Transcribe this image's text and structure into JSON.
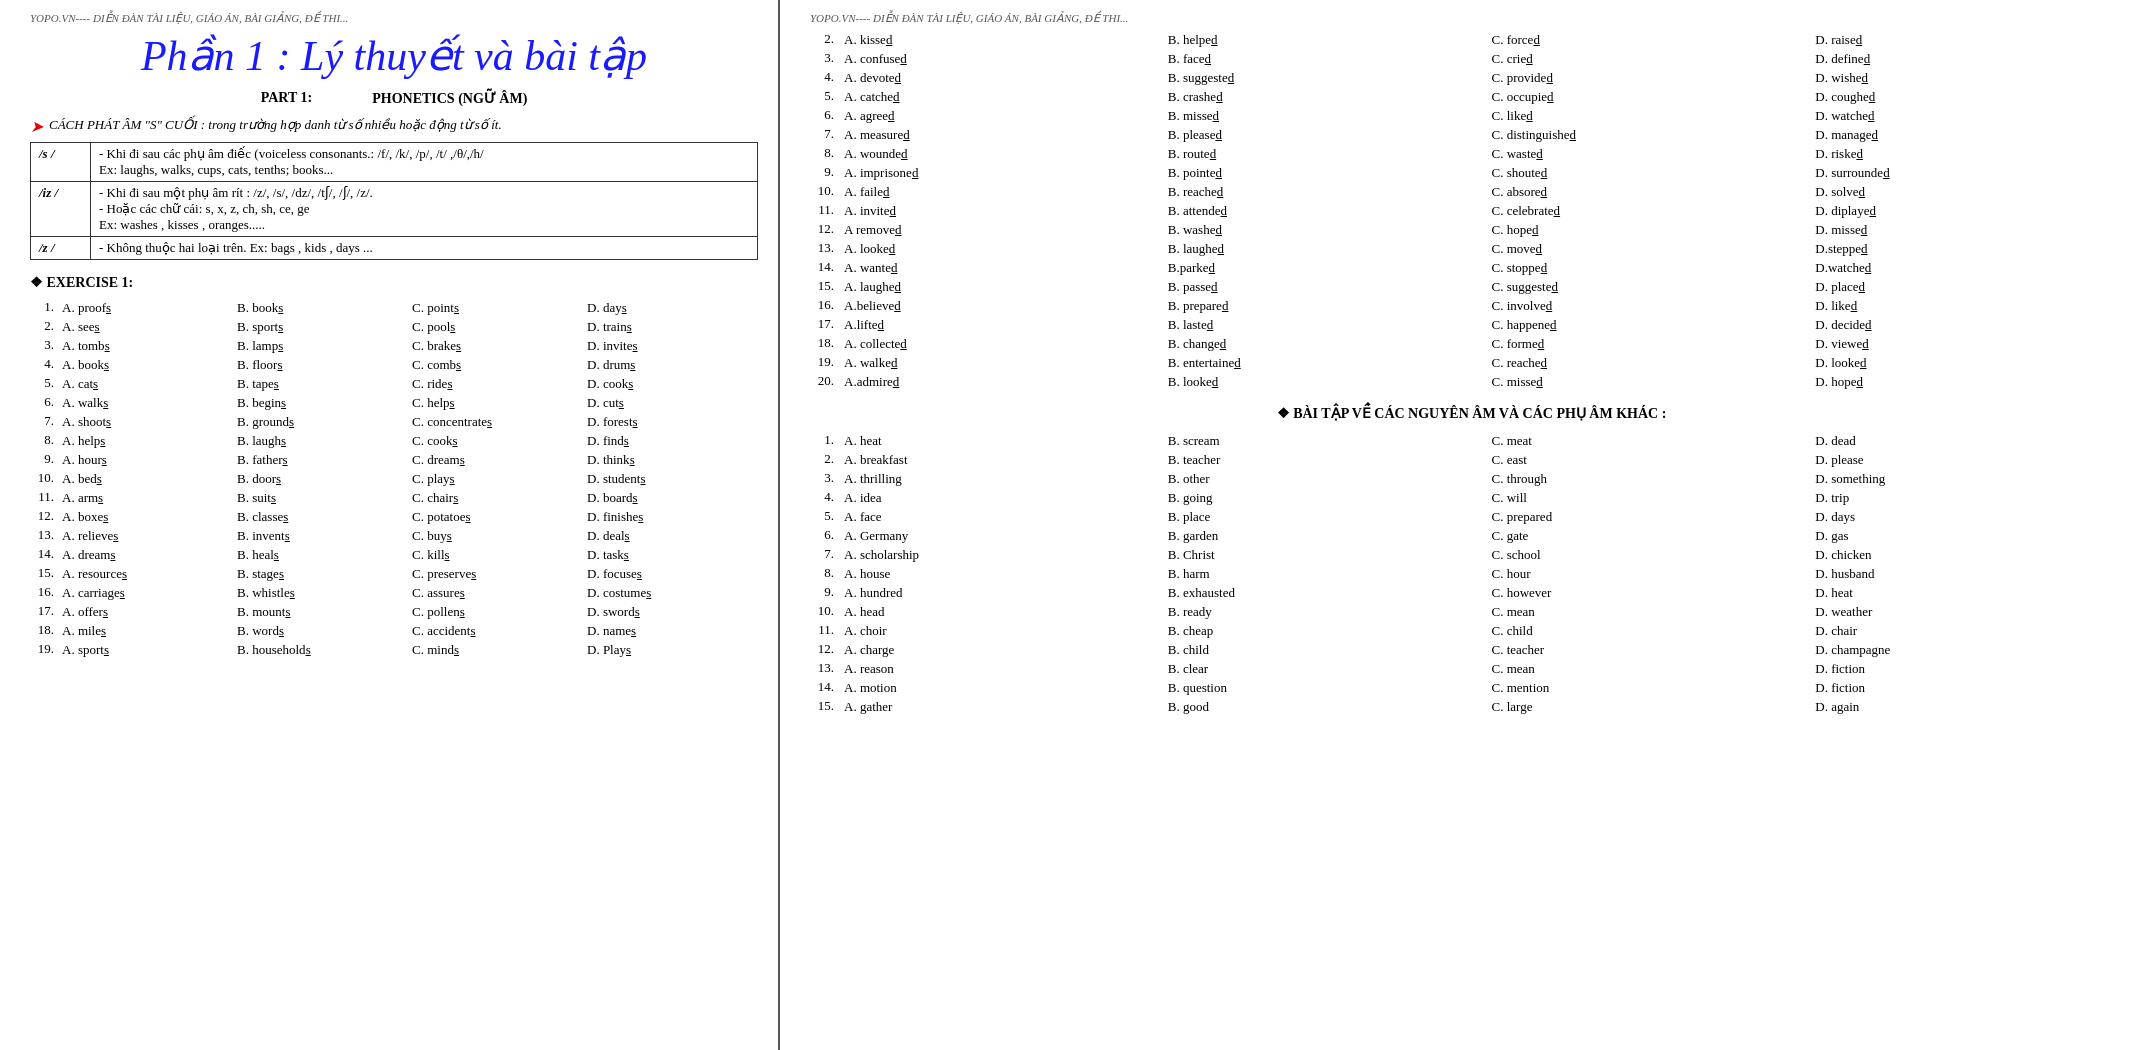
{
  "watermark": "YOPO.VN---- DIỄN ĐÀN TÀI LIỆU, GIÁO ÁN, BÀI GIẢNG, ĐỀ THI...",
  "title": "Phần 1 : Lý thuyết và bài tập",
  "part1_label": "PART 1:",
  "phonetics_label": "PHONETICS (NGỮ ÂM)",
  "instruction": "CÁCH PHÁT ÂM \"S\" CUỐI : trong trường hợp danh từ số nhiều  hoặc động từ số ít.",
  "phonetics_rows": [
    {
      "symbol": "/s /",
      "rule": "- Khi đi sau các phụ âm điếc (voiceless consonants.: /f/, /k/, /p/, /t/ ,/θ/,/h/\nEx: laughs, walks, cups, cats, tenths; books..."
    },
    {
      "symbol": "/iz /",
      "rule": "- Khi đi sau một phụ âm rít : /z/, /s/, /dz/, /tʃ/, /ʃ/, /z/.\n- Hoặc các chữ cái: s, x, z,  ch,  sh, ce, ge\nEx:   washes , kisses , oranges....."
    },
    {
      "symbol": "/z /",
      "rule": "- Không thuộc hai loại trên. Ex: bags , kids , days ..."
    }
  ],
  "exercise1_title": "❖  EXERCISE 1:",
  "exercise1_rows": [
    {
      "num": "1.",
      "a": "A. proofs",
      "b": "B. books",
      "c": "C. points",
      "d": "D. days"
    },
    {
      "num": "2.",
      "a": "A. sees",
      "b": "B. sports",
      "c": "C. pools",
      "d": "D. trains"
    },
    {
      "num": "3.",
      "a": "A. tombs",
      "b": "B. lamps",
      "c": "C. brakes",
      "d": "D. invites"
    },
    {
      "num": "4.",
      "a": "A. books",
      "b": "B. floors",
      "c": "C. combs",
      "d": "D. drums"
    },
    {
      "num": "5.",
      "a": "A. cats",
      "b": "B. tapes",
      "c": "C. rides",
      "d": "D. cooks"
    },
    {
      "num": "6.",
      "a": "A. walks",
      "b": "B. begins",
      "c": "C. helps",
      "d": "D. cuts"
    },
    {
      "num": "7.",
      "a": "A. shoots",
      "b": "B. grounds",
      "c": "C. concentrates",
      "d": "D. forests"
    },
    {
      "num": "8.",
      "a": "A. helps",
      "b": "B. laughs",
      "c": "C. cooks",
      "d": "D. finds"
    },
    {
      "num": "9.",
      "a": "A. hours",
      "b": "B. fathers",
      "c": "C. dreams",
      "d": "D. thinks"
    },
    {
      "num": "10.",
      "a": "A. beds",
      "b": "B. doors",
      "c": "C. plays",
      "d": "D. students"
    },
    {
      "num": "11.",
      "a": "A. arms",
      "b": "B. suits",
      "c": "C. chairs",
      "d": "D. boards"
    },
    {
      "num": "12.",
      "a": "A. boxes",
      "b": "B. classes",
      "c": "C. potatoes",
      "d": "D. finishes"
    },
    {
      "num": "13.",
      "a": "A. relieves",
      "b": "B. invents",
      "c": "C. buys",
      "d": "D. deals"
    },
    {
      "num": "14.",
      "a": "A. dreams",
      "b": "B. heals",
      "c": "C. kills",
      "d": "D. tasks"
    },
    {
      "num": "15.",
      "a": "A. resources",
      "b": "B. stages",
      "c": "C. preserves",
      "d": "D. focuses"
    },
    {
      "num": "16.",
      "a": "A. carriages",
      "b": "B. whistles",
      "c": "C. assures",
      "d": "D. costumes"
    },
    {
      "num": "17.",
      "a": "A. offers",
      "b": "B. mounts",
      "c": "C. pollens",
      "d": "D. swords"
    },
    {
      "num": "18.",
      "a": "A. miles",
      "b": "B. words",
      "c": "C. accidents",
      "d": "D. names"
    },
    {
      "num": "19.",
      "a": "A. sports",
      "b": "B. households",
      "c": "C. minds",
      "d": "D. Plays"
    }
  ],
  "right_watermark": "YOPO.VN---- DIỄN ĐÀN TÀI LIỆU, GIÁO ÁN, BÀI GIẢNG, ĐỀ THI...",
  "right_exercise_rows": [
    {
      "num": "2.",
      "a": "A. kissed",
      "b": "B. helped",
      "c": "C. forced",
      "d": "D. raised"
    },
    {
      "num": "3.",
      "a": "A. confused",
      "b": "B. faced",
      "c": "C. cried",
      "d": "D. defined"
    },
    {
      "num": "4.",
      "a": "A. devoted",
      "b": "B. suggested",
      "c": "C. provided",
      "d": "D. wished"
    },
    {
      "num": "5.",
      "a": "A. catched",
      "b": "B. crashed",
      "c": "C. occupied",
      "d": "D. coughed"
    },
    {
      "num": "6.",
      "a": "A. agreed",
      "b": "B. missed",
      "c": "C. liked",
      "d": "D. watched"
    },
    {
      "num": "7.",
      "a": "A. measured",
      "b": "B. pleased",
      "c": "C. distinguished",
      "d": "D. managed"
    },
    {
      "num": "8.",
      "a": "A. wounded",
      "b": "B. routed",
      "c": "C. wasted",
      "d": "D. risked"
    },
    {
      "num": "9.",
      "a": "A. imprisoned",
      "b": "B. pointed",
      "c": "C. shouted",
      "d": "D. surrounded"
    },
    {
      "num": "10.",
      "a": "A. failed",
      "b": "B. reached",
      "c": "C. absored",
      "d": "D. solved"
    },
    {
      "num": "11.",
      "a": "A. invited",
      "b": "B. attended",
      "c": "C. celebrated",
      "d": "D. diplayed"
    },
    {
      "num": "12.",
      "a": "A removed",
      "b": "B. washed",
      "c": "C. hoped",
      "d": "D. missed"
    },
    {
      "num": "13.",
      "a": "A. looked",
      "b": "B. laughed",
      "c": "C. moved",
      "d": "D.stepped"
    },
    {
      "num": "14.",
      "a": "A. wanted",
      "b": "B.parked",
      "c": "C. stopped",
      "d": "D.watched"
    },
    {
      "num": "15.",
      "a": "A. laughed",
      "b": "B. passed",
      "c": "C. suggested",
      "d": "D. placed"
    },
    {
      "num": "16.",
      "a": "A.believed",
      "b": "B. prepared",
      "c": "C. involved",
      "d": "D. liked"
    },
    {
      "num": "17.",
      "a": "A.lifted",
      "b": "B. lasted",
      "c": "C. happened",
      "d": "D. decided"
    },
    {
      "num": "18.",
      "a": "A. collected",
      "b": "B. changed",
      "c": "C. formed",
      "d": "D. viewed"
    },
    {
      "num": "19.",
      "a": "A. walked",
      "b": "B. entertained",
      "c": "C. reached",
      "d": "D. looked"
    },
    {
      "num": "20.",
      "a": "A.admired",
      "b": "B. looked",
      "c": "C. missed",
      "d": "D. hoped"
    }
  ],
  "vowels_header": "❖  BÀI TẬP VỀ  CÁC NGUYÊN ÂM VÀ CÁC PHỤ ÂM KHÁC :",
  "vowels_rows": [
    {
      "num": "1.",
      "a": "A. heat",
      "b": "B. scream",
      "c": "C. meat",
      "d": "D. dead"
    },
    {
      "num": "2.",
      "a": "A. breakfast",
      "b": "B. teacher",
      "c": "C. east",
      "d": "D.  please"
    },
    {
      "num": "3.",
      "a": "A.  thrilling",
      "b": "B. other",
      "c": "C.  through",
      "d": "D. something"
    },
    {
      "num": "4.",
      "a": "A.  idea",
      "b": "B.  going",
      "c": "C.  will",
      "d": "D.  trip"
    },
    {
      "num": "5.",
      "a": "A.  face",
      "b": "B.  place",
      "c": "C.  prepared",
      "d": "D.  days"
    },
    {
      "num": "6.",
      "a": "A.  Germany",
      "b": "B.  garden",
      "c": "C.  gate",
      "d": "D.  gas"
    },
    {
      "num": "7.",
      "a": "A.  scholarship",
      "b": "B.  Christ",
      "c": "C.  school",
      "d": "D.  chicken"
    },
    {
      "num": "8.",
      "a": "A.  house",
      "b": "B.  harm",
      "c": "C.  hour",
      "d": "D.  husband"
    },
    {
      "num": "9.",
      "a": "A.  hundred",
      "b": "B.  exhausted",
      "c": "C.  however",
      "d": "D.  heat"
    },
    {
      "num": "10.",
      "a": "A.  head",
      "b": "B.  ready",
      "c": "C.  mean",
      "d": "D.  weather"
    },
    {
      "num": "11.",
      "a": "A.  choir",
      "b": "B.  cheap",
      "c": "C.  child",
      "d": "D.  chair"
    },
    {
      "num": "12.",
      "a": "A.  charge",
      "b": "B.  child",
      "c": "C.  teacher",
      "d": "D.  champagne"
    },
    {
      "num": "13.",
      "a": "A.  reason",
      "b": "B.  clear",
      "c": "C.  mean",
      "d": "D.  fiction"
    },
    {
      "num": "14.",
      "a": "A.  motion",
      "b": "B.  question",
      "c": "C.  mention",
      "d": "D.  fiction"
    },
    {
      "num": "15.",
      "a": "A.  gather",
      "b": "B.  good",
      "c": "C.  large",
      "d": "D.  again"
    }
  ]
}
